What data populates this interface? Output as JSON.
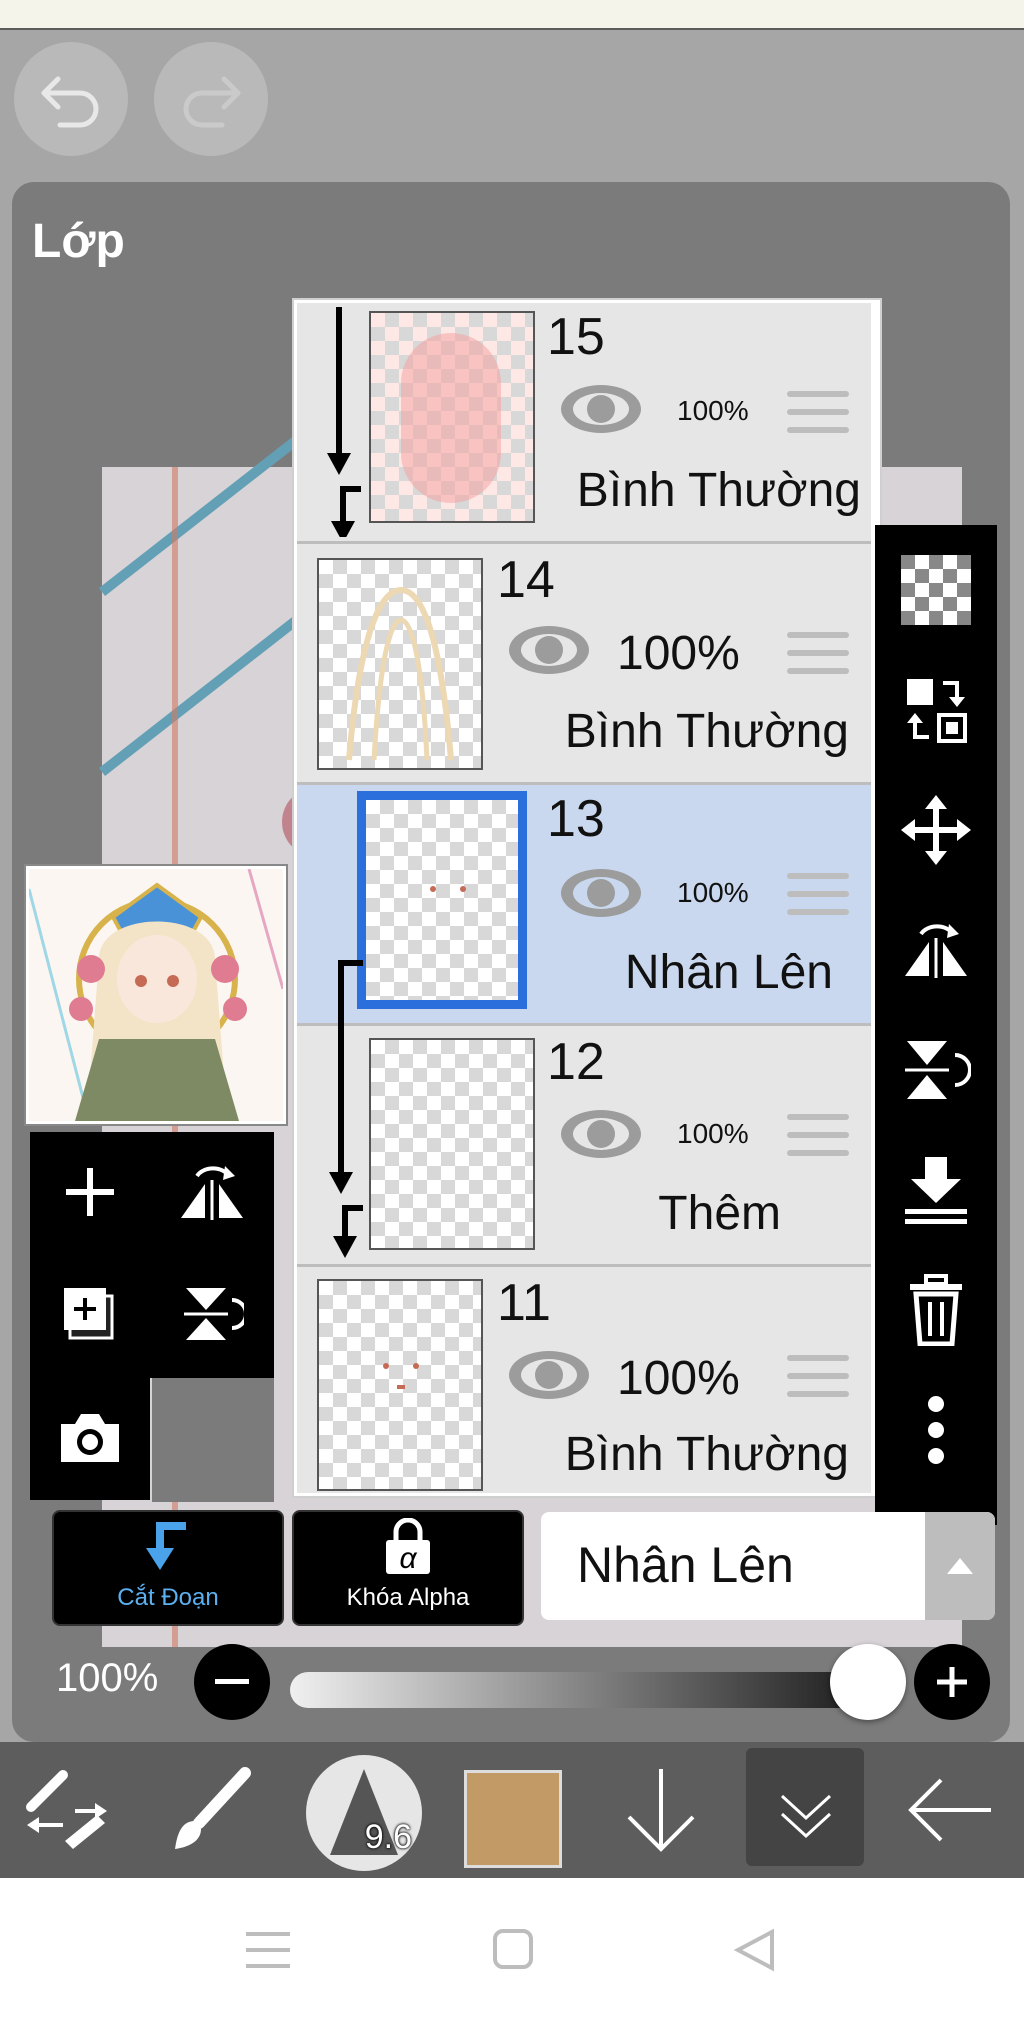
{
  "panel": {
    "title": "Lớp"
  },
  "layers": [
    {
      "num": "15",
      "opacity": "100%",
      "blend": "Bình Thường"
    },
    {
      "num": "14",
      "opacity": "100%",
      "blend": "Bình Thường"
    },
    {
      "num": "13",
      "opacity": "100%",
      "blend": "Nhân Lên",
      "selected": true
    },
    {
      "num": "12",
      "opacity": "100%",
      "blend": "Thêm"
    },
    {
      "num": "11",
      "opacity": "100%",
      "blend": "Bình Thường"
    }
  ],
  "controls": {
    "clip_label": "Cắt Đoạn",
    "alpha_lock_label": "Khóa Alpha",
    "alpha_symbol": "α",
    "blend_mode": "Nhân Lên",
    "opacity": "100%"
  },
  "toolbar": {
    "brush_size": "9.6",
    "color": "#c29a66"
  },
  "icons": [
    "undo-icon",
    "redo-icon",
    "checker-icon",
    "transfer-icon",
    "move-icon",
    "flip-h-icon",
    "flip-v-icon",
    "merge-down-icon",
    "trash-icon",
    "more-icon",
    "add-layer-icon",
    "add-layer-copy-icon",
    "camera-icon",
    "clip-icon",
    "lock-icon",
    "chevron-up-icon",
    "minus-icon",
    "plus-icon",
    "transform-icon",
    "brush-icon",
    "arrow-down-icon",
    "double-chevron-down-icon",
    "back-icon",
    "menu-nav-icon",
    "home-nav-icon",
    "back-nav-icon"
  ]
}
